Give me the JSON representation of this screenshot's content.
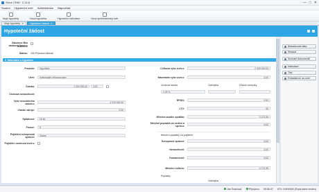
{
  "window": {
    "title": "Sivue CRM - 2.14.8",
    "minimize": "—",
    "maximize": "□",
    "close": "✕"
  },
  "menu": [
    "Soubor",
    "Hypoteční úvěr",
    "Administrace",
    "Nápověda"
  ],
  "toolbar": [
    {
      "label": "Moje hypotéky",
      "icon": "search-icon"
    },
    {
      "label": "Nová hypotéka",
      "icon": "new-document-icon"
    },
    {
      "label": "Hypoteční kalkulace",
      "icon": "calculator-icon"
    },
    {
      "label": "Nový spotřebitelský úvěr",
      "icon": "new-loan-icon"
    }
  ],
  "tabs": [
    {
      "label": "Moje hypotéky",
      "active": false
    },
    {
      "label": "Hypoteční žádost",
      "active": true
    }
  ],
  "header": {
    "title": "Hypoteční žádost"
  },
  "top_info": {
    "nocheck_label": "Založeno Bez zástavní firmou:",
    "brokers_label": "Brokeru:",
    "status_label": "Status:",
    "status_value": "100 Příprava žádosti"
  },
  "section": {
    "title": "Informace o hypotéce"
  },
  "left_fields": {
    "product_label": "Produkt:",
    "product_value": "Hypotéka",
    "purpose_label": "Účel:",
    "purpose_value": "Individuální refinancování",
    "amount_label": "Částka:",
    "amount_value": "2 000 000,00",
    "currency": "CZK",
    "fixation_label": "Úroková nemovitostí:",
    "own_label": "Výše investičního záměru:",
    "own_value": "1 000 000,00",
    "ownres_label": "Vlastní zdroje:",
    "ownres_value": "0,00",
    "maturity_label": "Splatnost:",
    "maturity_value": "20 let",
    "guarantee_label": "Fixace:",
    "guarantee_value": "5",
    "insurance_label": "Pojištění schopnosti splácet:",
    "insurance_value": "Žádné",
    "early_label": "Pojištění úmrtnost úvěru:"
  },
  "right_fields": {
    "total_label": "Celková výše úvěru:",
    "total_value": "2 000 000,00",
    "max_label": "Maximální výše úvěru:",
    "max_value": "0,00",
    "rate_head": "Úroková sazba",
    "deviation_head": "Odchylka",
    "reason_head": "Důvod odchylky",
    "rate_value": "2,99 %",
    "rpsn_label": "RPSN:",
    "rpsn_value": "3,52",
    "ltv_label": "LTV:",
    "ltv_value": "40",
    "monthly_label": "Měsíční anuitní splátka:",
    "monthly_value": "4 274,35",
    "fee_label": "Měsíční poplatek za vedení a správu:",
    "fee_value": "0,00",
    "insurance_head": "Měsíční poplatky za pojištění:",
    "ability_label": "Schopnost splácet:",
    "ability_value": "0,00",
    "property_label": "Nemovitosti:",
    "property_value": "0,00",
    "household_label": "Domácnosti:",
    "household_value": "0,00",
    "total_month_label": "Měsíční celkem:",
    "total_month_value": "4 274,35",
    "fees_label": "Poplatky",
    "fees_dev_label": "Odchylka"
  },
  "sidebar": [
    {
      "label": "Aktualizovat data",
      "icon": "refresh-icon"
    },
    {
      "label": "Smazat",
      "icon": "delete-icon"
    },
    {
      "label": "Seznam dokumentů",
      "icon": "documents-icon"
    },
    {
      "label": "Kalkulace",
      "icon": "calculator-icon"
    },
    {
      "label": "Tisk",
      "icon": "print-icon"
    },
    {
      "label": "Požádat/vrk na úvěr",
      "icon": "request-icon"
    }
  ],
  "status": {
    "user": "Jan Svačina1",
    "connection": "Připojeno",
    "time": "09:56:47",
    "account": "ATV 14000000 (Expa banki broker)"
  }
}
